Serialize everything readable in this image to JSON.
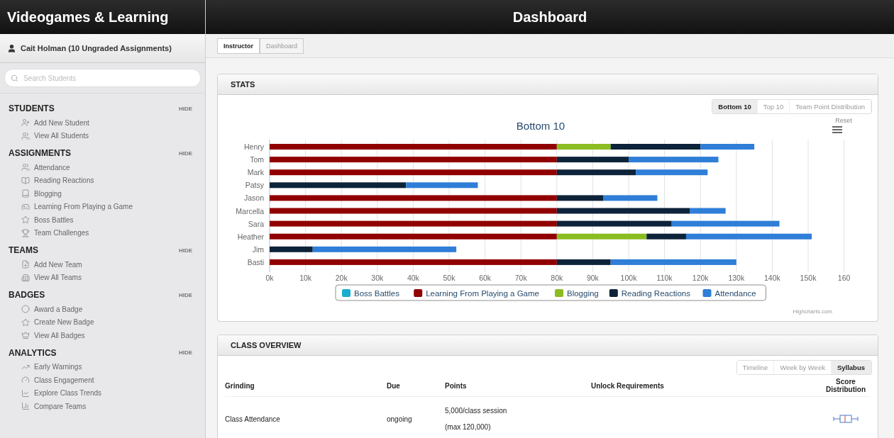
{
  "app_title": "Videogames & Learning",
  "page_title": "Dashboard",
  "user": {
    "name": "Cait Holman (10 Ungraded Assignments)"
  },
  "search": {
    "placeholder": "Search Students"
  },
  "sidebar": {
    "sections": [
      {
        "title": "STUDENTS",
        "action": "HIDE",
        "items": [
          {
            "label": "Add New Student"
          },
          {
            "label": "View All Students"
          }
        ]
      },
      {
        "title": "ASSIGNMENTS",
        "action": "HIDE",
        "items": [
          {
            "label": "Attendance"
          },
          {
            "label": "Reading Reactions"
          },
          {
            "label": "Blogging"
          },
          {
            "label": "Learning From Playing a Game"
          },
          {
            "label": "Boss Battles"
          },
          {
            "label": "Team Challenges"
          }
        ]
      },
      {
        "title": "TEAMS",
        "action": "HIDE",
        "items": [
          {
            "label": "Add New Team"
          },
          {
            "label": "View All Teams"
          }
        ]
      },
      {
        "title": "BADGES",
        "action": "HIDE",
        "items": [
          {
            "label": "Award a Badge"
          },
          {
            "label": "Create New Badge"
          },
          {
            "label": "View All Badges"
          }
        ]
      },
      {
        "title": "ANALYTICS",
        "action": "HIDE",
        "items": [
          {
            "label": "Early Warnings"
          },
          {
            "label": "Class Engagement"
          },
          {
            "label": "Explore Class Trends"
          },
          {
            "label": "Compare Teams"
          }
        ]
      }
    ]
  },
  "breadcrumb": [
    {
      "label": "Instructor",
      "current": false
    },
    {
      "label": "Dashboard",
      "current": true
    }
  ],
  "stats": {
    "title": "STATS",
    "tabs": [
      {
        "label": "Bottom 10",
        "selected": true
      },
      {
        "label": "Top 10",
        "selected": false
      },
      {
        "label": "Team Point Distribution",
        "selected": false
      }
    ],
    "reset_label": "Reset",
    "credit": "Highcharts.com",
    "chart_data": {
      "type": "bar",
      "orientation": "horizontal",
      "stacked": true,
      "grid": true,
      "legend": true,
      "title": "Bottom 10",
      "categories": [
        "Henry",
        "Tom",
        "Mark",
        "Patsy",
        "Jason",
        "Marcella",
        "Sara",
        "Heather",
        "Jim",
        "Basti"
      ],
      "xlim": [
        0,
        160
      ],
      "xticks": [
        {
          "value": 0,
          "label": "0k"
        },
        {
          "value": 10,
          "label": "10k"
        },
        {
          "value": 20,
          "label": "20k"
        },
        {
          "value": 30,
          "label": "30k"
        },
        {
          "value": 40,
          "label": "40k"
        },
        {
          "value": 50,
          "label": "50k"
        },
        {
          "value": 60,
          "label": "60k"
        },
        {
          "value": 70,
          "label": "70k"
        },
        {
          "value": 80,
          "label": "80k"
        },
        {
          "value": 90,
          "label": "90k"
        },
        {
          "value": 100,
          "label": "100k"
        },
        {
          "value": 110,
          "label": "110k"
        },
        {
          "value": 120,
          "label": "120k"
        },
        {
          "value": 130,
          "label": "130k"
        },
        {
          "value": 140,
          "label": "140k"
        },
        {
          "value": 150,
          "label": "150k"
        },
        {
          "value": 160,
          "label": "160"
        }
      ],
      "series": [
        {
          "name": "Boss Battles",
          "color": "#1aadce",
          "values": [
            null,
            null,
            null,
            null,
            null,
            null,
            null,
            null,
            null,
            null
          ]
        },
        {
          "name": "Learning From Playing a Game",
          "color": "#910000",
          "values": [
            80,
            80,
            80,
            null,
            80,
            80,
            80,
            80,
            null,
            80
          ]
        },
        {
          "name": "Blogging",
          "color": "#8bbc21",
          "values": [
            15,
            null,
            null,
            null,
            null,
            null,
            null,
            25,
            null,
            null
          ]
        },
        {
          "name": "Reading Reactions",
          "color": "#0d233a",
          "values": [
            25,
            20,
            22,
            38,
            13,
            37,
            32,
            11,
            12,
            15
          ]
        },
        {
          "name": "Attendance",
          "color": "#2f7ed8",
          "values": [
            15,
            25,
            20,
            20,
            15,
            10,
            30,
            35,
            40,
            35
          ]
        }
      ]
    }
  },
  "class_overview": {
    "title": "CLASS OVERVIEW",
    "tabs": [
      {
        "label": "Timeline",
        "selected": false
      },
      {
        "label": "Week by Week",
        "selected": false
      },
      {
        "label": "Syllabus",
        "selected": true
      }
    ],
    "columns": [
      "Grinding",
      "Due",
      "Points",
      "Unlock Requirements",
      "Score Distribution"
    ],
    "rows": [
      {
        "name": "Class Attendance",
        "due": "ongoing",
        "points": [
          "5,000/class session",
          "(max 120,000)"
        ]
      }
    ]
  }
}
